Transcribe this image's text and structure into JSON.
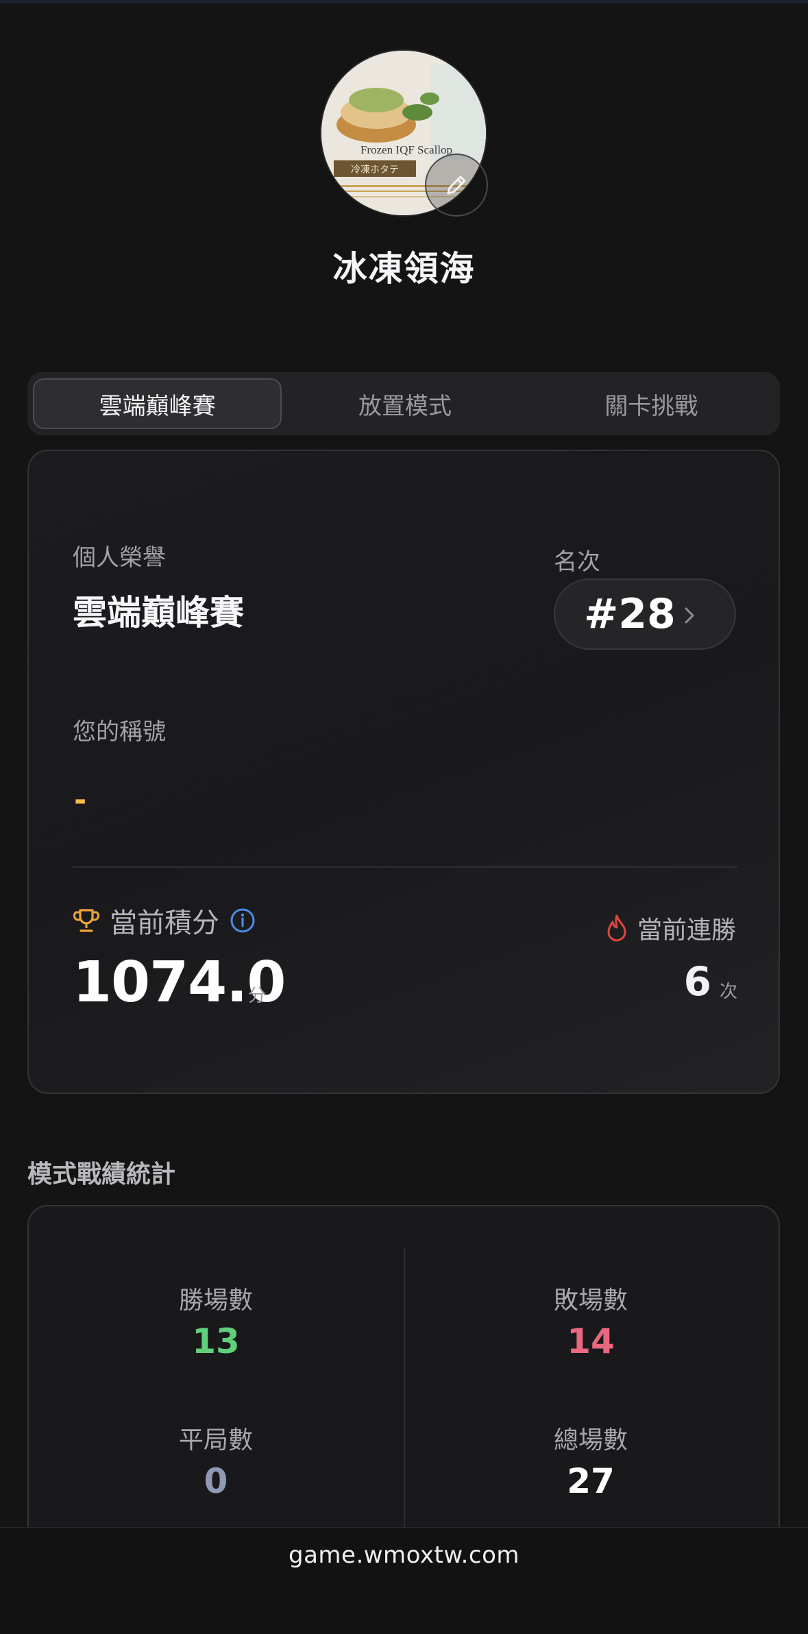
{
  "profile": {
    "username": "冰凍領海",
    "avatar_text": "Frozen IQF Scallop",
    "avatar_subtext": "冷凍ホタテ"
  },
  "tabs": [
    {
      "label": "雲端巔峰賽",
      "active": true
    },
    {
      "label": "放置模式",
      "active": false
    },
    {
      "label": "關卡挑戰",
      "active": false
    }
  ],
  "honor": {
    "section_label": "個人榮譽",
    "title": "雲端巔峰賽",
    "rank_label": "名次",
    "rank_value": "#28",
    "nickname_label": "您的稱號",
    "nickname_value": "-",
    "score_label": "當前積分",
    "score_value": "1074.0",
    "score_unit": "分",
    "streak_label": "當前連勝",
    "streak_value": "6",
    "streak_unit": "次"
  },
  "stats": {
    "heading": "模式戰績統計",
    "wins_label": "勝場數",
    "wins_value": "13",
    "losses_label": "敗場數",
    "losses_value": "14",
    "draws_label": "平局數",
    "draws_value": "0",
    "total_label": "總場數",
    "total_value": "27"
  },
  "colors": {
    "wins": "#5fcf7a",
    "losses": "#e8687f",
    "draws": "#8e9ab3",
    "total": "#ffffff",
    "trophy": "#f0a53a",
    "flame": "#e0463e",
    "info": "#4b8ce8",
    "nickname": "#f5b945"
  },
  "browser": {
    "url": "game.wmoxtw.com"
  }
}
